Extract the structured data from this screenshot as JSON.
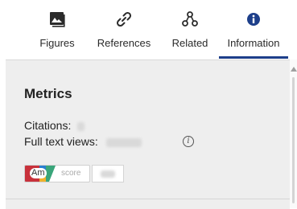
{
  "tabs": [
    {
      "label": "Figures",
      "icon": "image-icon"
    },
    {
      "label": "References",
      "icon": "link-icon"
    },
    {
      "label": "Related",
      "icon": "network-icon"
    },
    {
      "label": "Information",
      "icon": "info-icon"
    }
  ],
  "active_tab": "Information",
  "metrics": {
    "title": "Metrics",
    "citations_label": "Citations:",
    "full_text_views_label": "Full text views:",
    "altmetric": {
      "badge_text": "Am",
      "score_label": "score"
    }
  },
  "colors": {
    "active_underline": "#1d3f8a",
    "info_icon_fill": "#1d3f8a",
    "panel_bg": "#eeeeee"
  }
}
